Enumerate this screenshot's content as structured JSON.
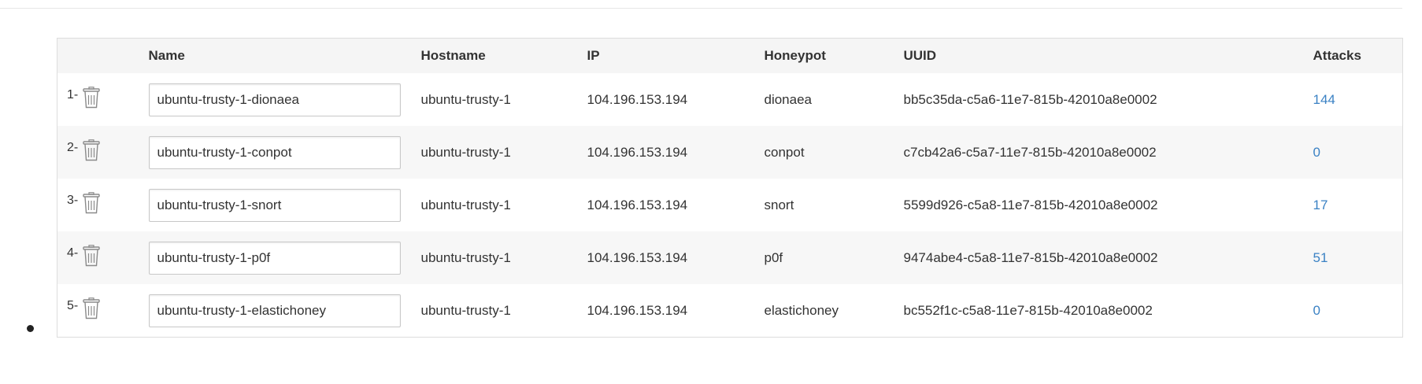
{
  "table": {
    "headers": {
      "index": "",
      "name": "Name",
      "hostname": "Hostname",
      "ip": "IP",
      "honeypot": "Honeypot",
      "uuid": "UUID",
      "attacks": "Attacks"
    },
    "rows": [
      {
        "index": "1-",
        "name": "ubuntu-trusty-1-dionaea",
        "hostname": "ubuntu-trusty-1",
        "ip": "104.196.153.194",
        "honeypot": "dionaea",
        "uuid": "bb5c35da-c5a6-11e7-815b-42010a8e0002",
        "attacks": "144"
      },
      {
        "index": "2-",
        "name": "ubuntu-trusty-1-conpot",
        "hostname": "ubuntu-trusty-1",
        "ip": "104.196.153.194",
        "honeypot": "conpot",
        "uuid": "c7cb42a6-c5a7-11e7-815b-42010a8e0002",
        "attacks": "0"
      },
      {
        "index": "3-",
        "name": "ubuntu-trusty-1-snort",
        "hostname": "ubuntu-trusty-1",
        "ip": "104.196.153.194",
        "honeypot": "snort",
        "uuid": "5599d926-c5a8-11e7-815b-42010a8e0002",
        "attacks": "17"
      },
      {
        "index": "4-",
        "name": "ubuntu-trusty-1-p0f",
        "hostname": "ubuntu-trusty-1",
        "ip": "104.196.153.194",
        "honeypot": "p0f",
        "uuid": "9474abe4-c5a8-11e7-815b-42010a8e0002",
        "attacks": "51"
      },
      {
        "index": "5-",
        "name": "ubuntu-trusty-1-elastichoney",
        "hostname": "ubuntu-trusty-1",
        "ip": "104.196.153.194",
        "honeypot": "elastichoney",
        "uuid": "bc552f1c-c5a8-11e7-815b-42010a8e0002",
        "attacks": "0"
      }
    ]
  },
  "icons": {
    "delete": "trash-icon",
    "list_marker": "bullet"
  },
  "colors": {
    "link": "#3b82c4",
    "header_bg": "#f5f5f5",
    "stripe_bg": "#f7f7f7",
    "border": "#dddddd"
  }
}
